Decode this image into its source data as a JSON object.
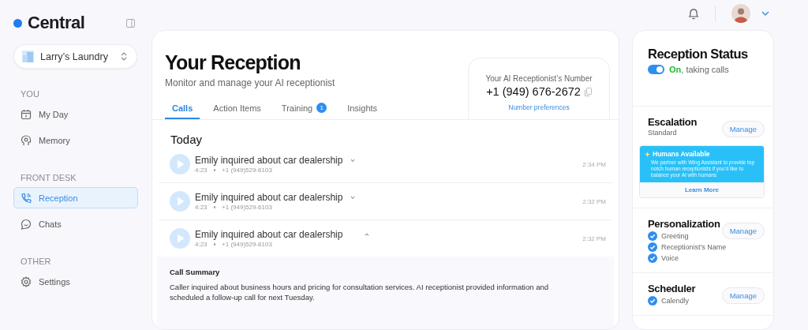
{
  "brand": {
    "name": "Central"
  },
  "workspace": {
    "name": "Larry’s Laundry"
  },
  "nav": [
    {
      "heading": "YOU",
      "items": [
        {
          "label": "My Day",
          "kind": "calendar",
          "selected": false
        },
        {
          "label": "Memory",
          "kind": "memory",
          "selected": false
        }
      ]
    },
    {
      "heading": "FRONT DESK",
      "items": [
        {
          "label": "Reception",
          "kind": "phone",
          "selected": true
        },
        {
          "label": "Chats",
          "kind": "chat",
          "selected": false
        }
      ]
    },
    {
      "heading": "OTHER",
      "items": [
        {
          "label": "Settings",
          "kind": "gear",
          "selected": false
        }
      ]
    }
  ],
  "page": {
    "title": "Your Reception",
    "subtitle": "Monitor and manage your AI receptionist"
  },
  "tabs": [
    {
      "label": "Calls",
      "selected": true
    },
    {
      "label": "Action Items",
      "selected": false
    },
    {
      "label": "Training",
      "selected": false,
      "badge": "1"
    },
    {
      "label": "Insights",
      "selected": false
    }
  ],
  "number_card": {
    "label": "Your AI Receptionist’s Number",
    "number": "+1 (949) 676-2672",
    "link": "Number preferences"
  },
  "calls_group": "Today",
  "calls": [
    {
      "title": "Emily inquired about car dealership",
      "duration": "4:23",
      "phone": "+1 (949)529-6103",
      "time": "2:34 PM",
      "expanded": false
    },
    {
      "title": "Emily inquired about car dealership",
      "duration": "4:23",
      "phone": "+1 (949)529-6103",
      "time": "2:32 PM",
      "expanded": false
    },
    {
      "title": "Emily inquired about car dealership",
      "duration": "4:23",
      "phone": "+1 (949)529-6103",
      "time": "2:32 PM",
      "expanded": true,
      "summary_title": "Call Summary",
      "summary": "Caller inquired about business hours and pricing for consultation services. AI receptionist provided information and scheduled a follow-up call for next Tuesday."
    }
  ],
  "status": {
    "title": "Reception Status",
    "on": true,
    "state": "On",
    "detail": ", taking calls"
  },
  "escalation": {
    "title": "Escalation",
    "value": "Standard",
    "button": "Manage"
  },
  "promo": {
    "title": "Humans Available",
    "text": "We partner with Wing Assistant to provide top notch human receptionists if you’d like to balance your AI with humans",
    "link": "Learn More"
  },
  "personalization": {
    "title": "Personalization",
    "button": "Manage",
    "items": [
      {
        "label": "Greeting",
        "checked": true
      },
      {
        "label": "Receptionist’s Name",
        "checked": true
      },
      {
        "label": "Voice",
        "checked": true
      }
    ]
  },
  "scheduler": {
    "title": "Scheduler",
    "button": "Manage",
    "items": [
      {
        "label": "Calendly",
        "checked": true
      }
    ]
  }
}
